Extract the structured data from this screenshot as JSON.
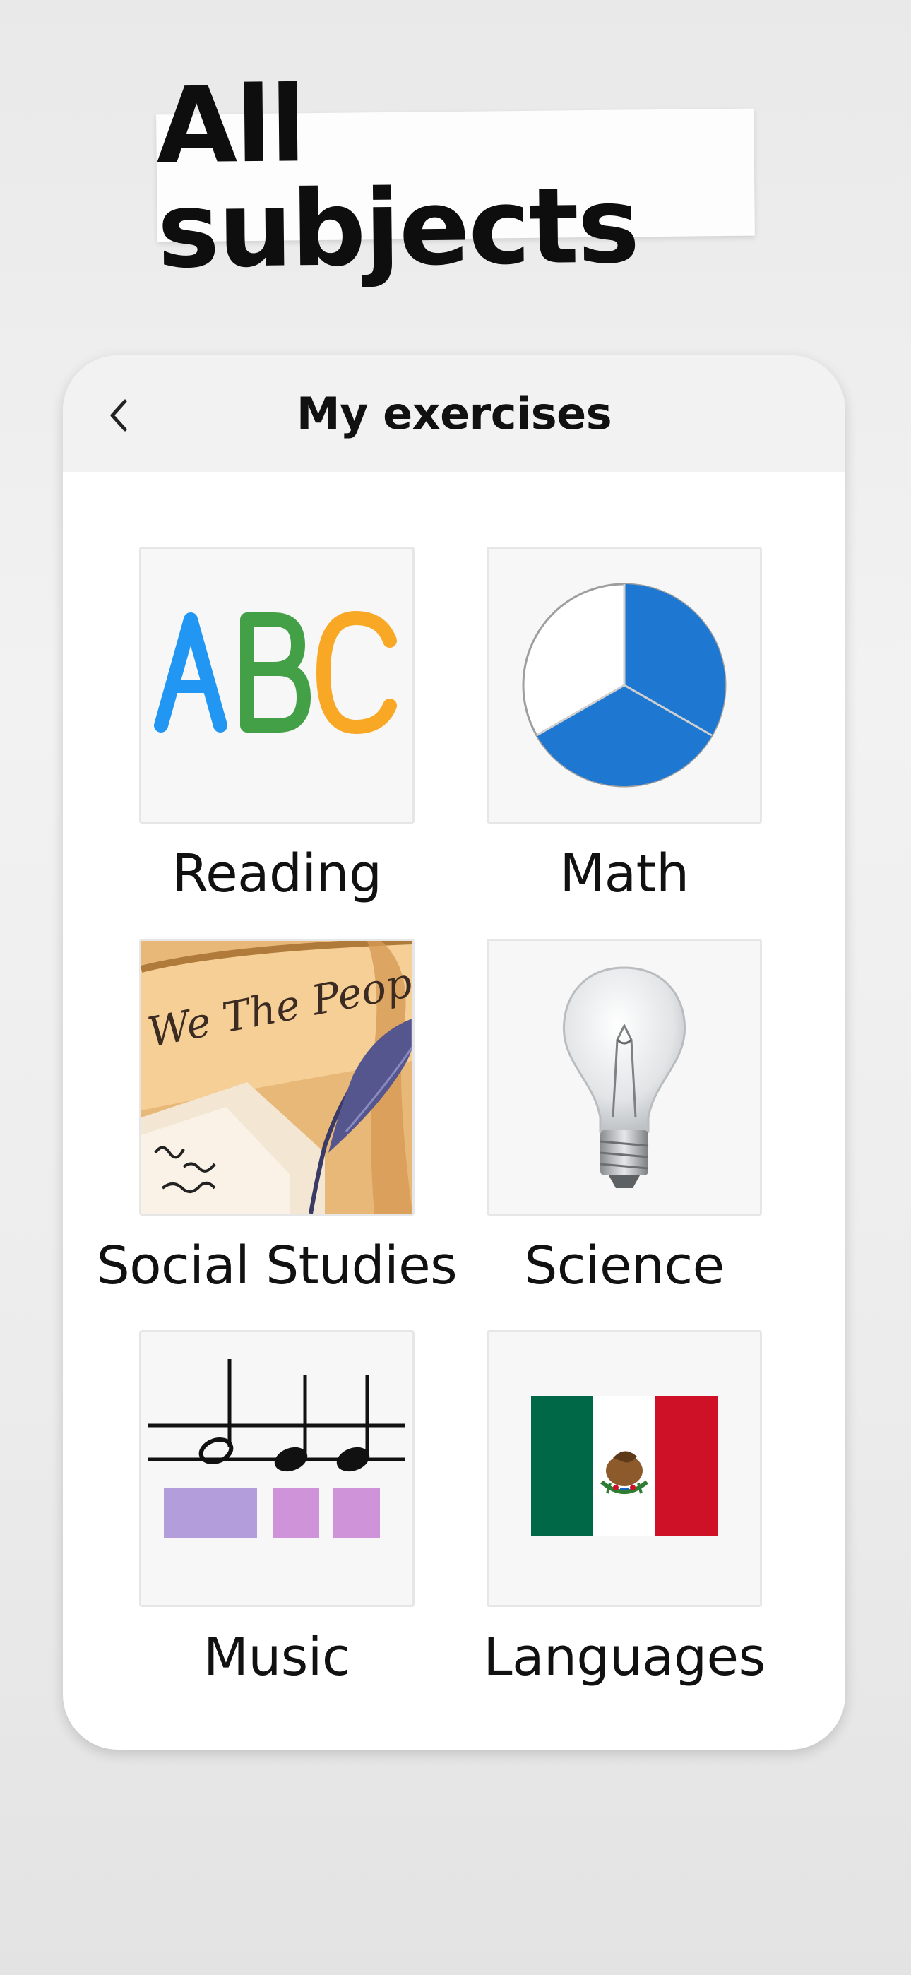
{
  "headline": "All subjects",
  "screen": {
    "title": "My exercises"
  },
  "subjects": [
    {
      "label": "Reading",
      "icon": "abc-letters-icon"
    },
    {
      "label": "Math",
      "icon": "pie-chart-icon"
    },
    {
      "label": "Social Studies",
      "icon": "we-the-people-scroll-icon",
      "image_text": "We The People"
    },
    {
      "label": "Science",
      "icon": "light-bulb-icon"
    },
    {
      "label": "Music",
      "icon": "music-notes-icon"
    },
    {
      "label": "Languages",
      "icon": "mexico-flag-icon"
    }
  ],
  "colors": {
    "abc_a": "#2196f3",
    "abc_b": "#43a047",
    "abc_c": "#f9a825",
    "math_fill": "#1e78d2",
    "flag_green": "#006847",
    "flag_red": "#ce1126",
    "music_block": "#b39ddb"
  }
}
